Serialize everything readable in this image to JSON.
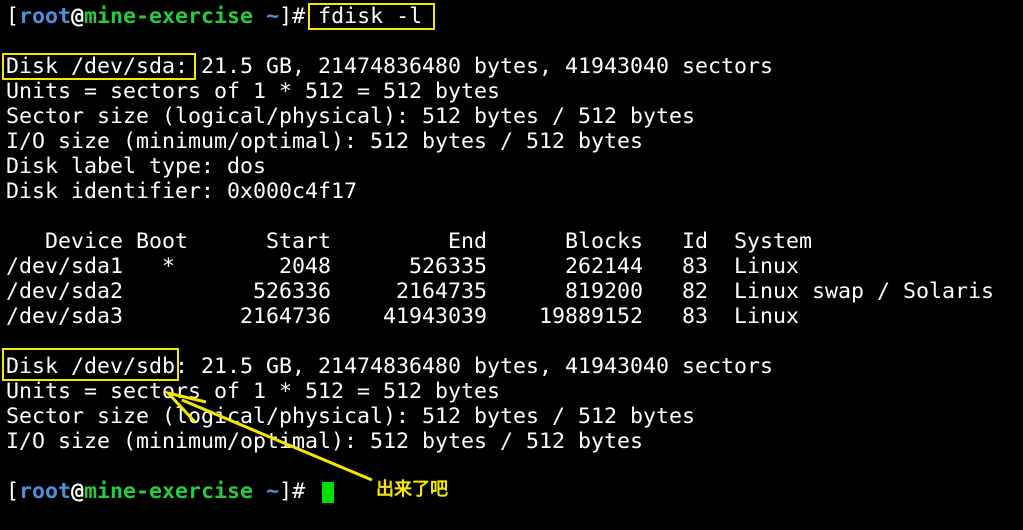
{
  "prompt": {
    "open_bracket": "[",
    "user": "root",
    "at": "@",
    "host": "mine-exercise",
    "path": "~",
    "close_bracket": "]#"
  },
  "command": "fdisk -l",
  "sda": {
    "disk_label": "Disk /dev/sda:",
    "disk_size": " 21.5 GB, 21474836480 bytes, 41943040 sectors",
    "units": "Units = sectors of 1 * 512 = 512 bytes",
    "sector_size": "Sector size (logical/physical): 512 bytes / 512 bytes",
    "io_size": "I/O size (minimum/optimal): 512 bytes / 512 bytes",
    "label_type": "Disk label type: dos",
    "identifier": "Disk identifier: 0x000c4f17"
  },
  "partition_table": {
    "header": "   Device Boot      Start         End      Blocks   Id  System",
    "rows": [
      "/dev/sda1   *        2048      526335      262144   83  Linux",
      "/dev/sda2          526336     2164735      819200   82  Linux swap / Solaris",
      "/dev/sda3         2164736    41943039    19889152   83  Linux"
    ]
  },
  "sdb": {
    "disk_label": "Disk /dev/sdb:",
    "disk_size": " 21.5 GB, 21474836480 bytes, 41943040 sectors",
    "units": "Units = sectors of 1 * 512 = 512 bytes",
    "sector_size": "Sector size (logical/physical): 512 bytes / 512 bytes",
    "io_size": "I/O size (minimum/optimal): 512 bytes / 512 bytes"
  },
  "annotation": "出来了吧",
  "colors": {
    "background": "#000000",
    "text": "#ffffff",
    "user": "#4f8fd9",
    "host": "#27c93f",
    "highlight": "#f5e800",
    "cursor": "#00e000"
  }
}
